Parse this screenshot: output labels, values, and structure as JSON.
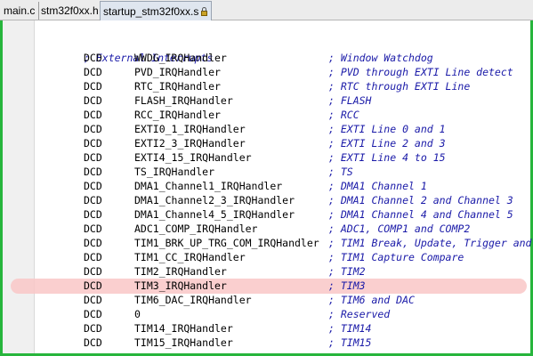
{
  "tabs": [
    {
      "label": "main.c"
    },
    {
      "label": "stm32f0xx.h"
    },
    {
      "label": "startup_stm32f0xx.s",
      "locked": true,
      "active": true
    }
  ],
  "icons": {
    "lock": "lock-icon"
  },
  "colors": {
    "frame_border": "#27b53c",
    "comment": "#1a1aa8",
    "highlight": "#f9c7c7"
  },
  "code": {
    "header_comment": "; External Interrupts",
    "lines": [
      {
        "kw": "DCD",
        "name": "WWDG_IRQHandler",
        "comment": "; Window Watchdog"
      },
      {
        "kw": "DCD",
        "name": "PVD_IRQHandler",
        "comment": "; PVD through EXTI Line detect"
      },
      {
        "kw": "DCD",
        "name": "RTC_IRQHandler",
        "comment": "; RTC through EXTI Line"
      },
      {
        "kw": "DCD",
        "name": "FLASH_IRQHandler",
        "comment": "; FLASH"
      },
      {
        "kw": "DCD",
        "name": "RCC_IRQHandler",
        "comment": "; RCC"
      },
      {
        "kw": "DCD",
        "name": "EXTI0_1_IRQHandler",
        "comment": "; EXTI Line 0 and 1"
      },
      {
        "kw": "DCD",
        "name": "EXTI2_3_IRQHandler",
        "comment": "; EXTI Line 2 and 3"
      },
      {
        "kw": "DCD",
        "name": "EXTI4_15_IRQHandler",
        "comment": "; EXTI Line 4 to 15"
      },
      {
        "kw": "DCD",
        "name": "TS_IRQHandler",
        "comment": "; TS"
      },
      {
        "kw": "DCD",
        "name": "DMA1_Channel1_IRQHandler",
        "comment": "; DMA1 Channel 1"
      },
      {
        "kw": "DCD",
        "name": "DMA1_Channel2_3_IRQHandler",
        "comment": "; DMA1 Channel 2 and Channel 3"
      },
      {
        "kw": "DCD",
        "name": "DMA1_Channel4_5_IRQHandler",
        "comment": "; DMA1 Channel 4 and Channel 5"
      },
      {
        "kw": "DCD",
        "name": "ADC1_COMP_IRQHandler",
        "comment": "; ADC1, COMP1 and COMP2"
      },
      {
        "kw": "DCD",
        "name": "TIM1_BRK_UP_TRG_COM_IRQHandler",
        "comment": "; TIM1 Break, Update, Trigger and"
      },
      {
        "kw": "DCD",
        "name": "TIM1_CC_IRQHandler",
        "comment": "; TIM1 Capture Compare"
      },
      {
        "kw": "DCD",
        "name": "TIM2_IRQHandler",
        "comment": "; TIM2"
      },
      {
        "kw": "DCD",
        "name": "TIM3_IRQHandler",
        "comment": "; TIM3",
        "highlighted": true
      },
      {
        "kw": "DCD",
        "name": "TIM6_DAC_IRQHandler",
        "comment": "; TIM6 and DAC"
      },
      {
        "kw": "DCD",
        "name": "0",
        "comment": "; Reserved"
      },
      {
        "kw": "DCD",
        "name": "TIM14_IRQHandler",
        "comment": "; TIM14"
      },
      {
        "kw": "DCD",
        "name": "TIM15_IRQHandler",
        "comment": "; TIM15"
      }
    ]
  }
}
